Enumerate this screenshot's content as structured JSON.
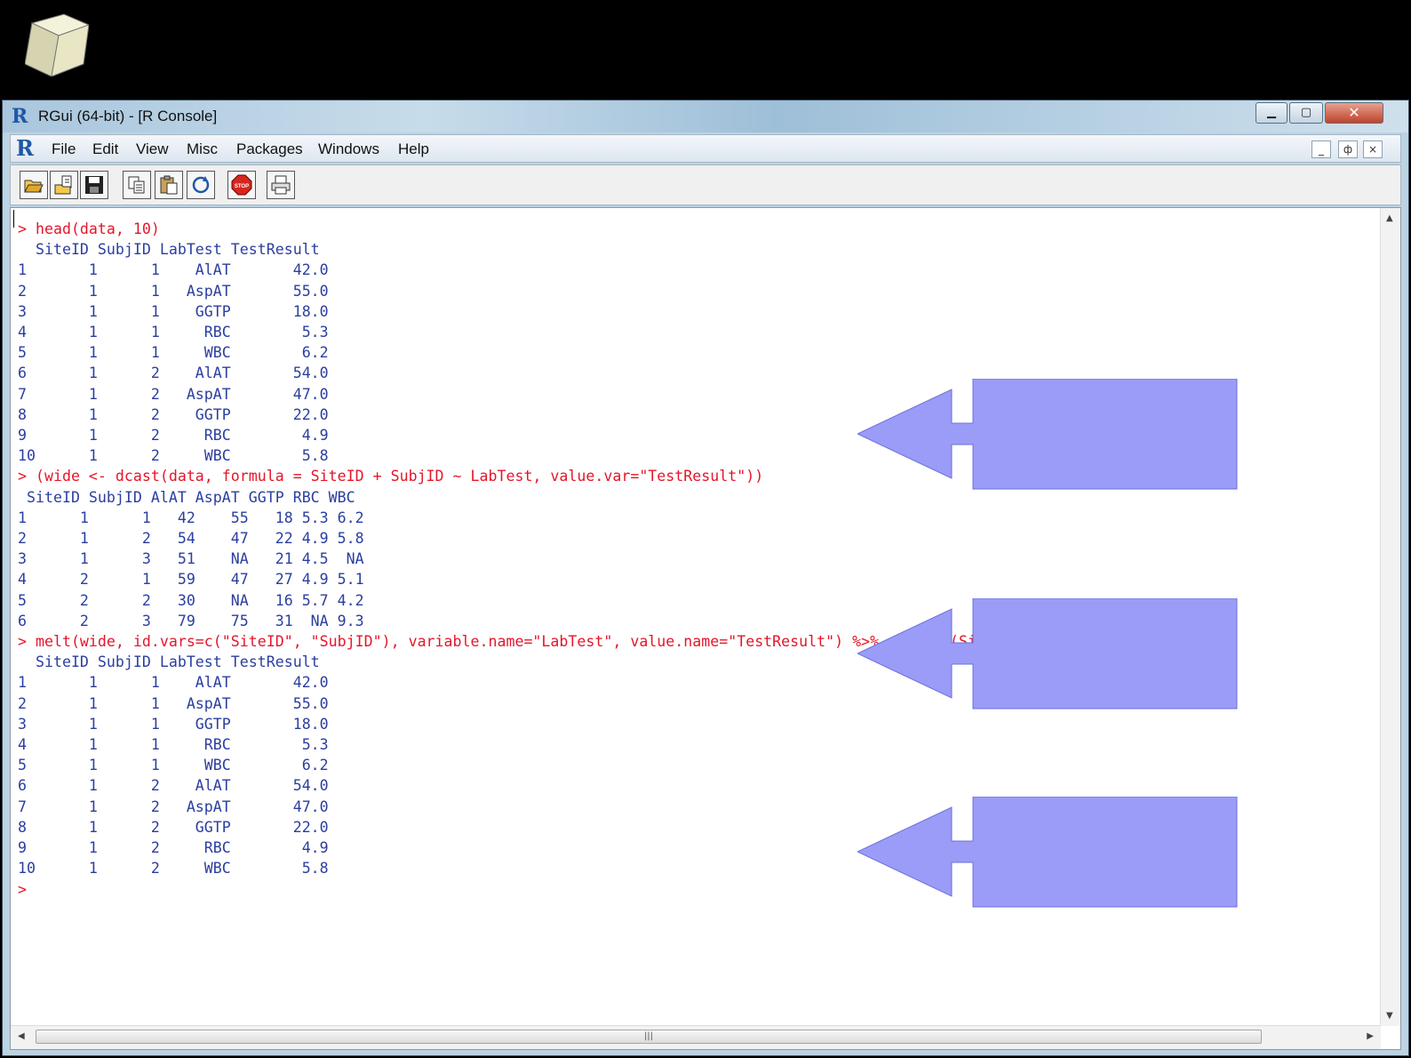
{
  "window": {
    "title": "RGui (64-bit) - [R Console]",
    "app_icon": "R"
  },
  "menu": {
    "items": [
      "File",
      "Edit",
      "View",
      "Misc",
      "Packages",
      "Windows",
      "Help"
    ],
    "mdi_buttons": [
      "_",
      "ф",
      "×"
    ]
  },
  "toolbar": {
    "buttons": [
      "open-script-icon",
      "load-workspace-icon",
      "save-icon",
      "copy-icon",
      "paste-icon",
      "refresh-icon",
      "stop-icon",
      "print-icon"
    ]
  },
  "console": {
    "lines": [
      {
        "type": "cmd",
        "text": "> head(data, 10)"
      },
      {
        "type": "out",
        "text": "  SiteID SubjID LabTest TestResult"
      },
      {
        "type": "out",
        "text": "1       1      1    AlAT       42.0"
      },
      {
        "type": "out",
        "text": "2       1      1   AspAT       55.0"
      },
      {
        "type": "out",
        "text": "3       1      1    GGTP       18.0"
      },
      {
        "type": "out",
        "text": "4       1      1     RBC        5.3"
      },
      {
        "type": "out",
        "text": "5       1      1     WBC        6.2"
      },
      {
        "type": "out",
        "text": "6       1      2    AlAT       54.0"
      },
      {
        "type": "out",
        "text": "7       1      2   AspAT       47.0"
      },
      {
        "type": "out",
        "text": "8       1      2    GGTP       22.0"
      },
      {
        "type": "out",
        "text": "9       1      2     RBC        4.9"
      },
      {
        "type": "out",
        "text": "10      1      2     WBC        5.8"
      },
      {
        "type": "cmd",
        "text": "> (wide <- dcast(data, formula = SiteID + SubjID ~ LabTest, value.var=\"TestResult\"))"
      },
      {
        "type": "out",
        "text": " SiteID SubjID AlAT AspAT GGTP RBC WBC"
      },
      {
        "type": "out",
        "text": "1      1      1   42    55   18 5.3 6.2"
      },
      {
        "type": "out",
        "text": "2      1      2   54    47   22 4.9 5.8"
      },
      {
        "type": "out",
        "text": "3      1      3   51    NA   21 4.5  NA"
      },
      {
        "type": "out",
        "text": "4      2      1   59    47   27 4.9 5.1"
      },
      {
        "type": "out",
        "text": "5      2      2   30    NA   16 5.7 4.2"
      },
      {
        "type": "out",
        "text": "6      2      3   79    75   31  NA 9.3"
      },
      {
        "type": "cmd",
        "text": "> melt(wide, id.vars=c(\"SiteID\", \"SubjID\"), variable.name=\"LabTest\", value.name=\"TestResult\") %>% arrange(SiteID, SubjID) %>% hea$"
      },
      {
        "type": "out",
        "text": "  SiteID SubjID LabTest TestResult"
      },
      {
        "type": "out",
        "text": "1       1      1    AlAT       42.0"
      },
      {
        "type": "out",
        "text": "2       1      1   AspAT       55.0"
      },
      {
        "type": "out",
        "text": "3       1      1    GGTP       18.0"
      },
      {
        "type": "out",
        "text": "4       1      1     RBC        5.3"
      },
      {
        "type": "out",
        "text": "5       1      1     WBC        6.2"
      },
      {
        "type": "out",
        "text": "6       1      2    AlAT       54.0"
      },
      {
        "type": "out",
        "text": "7       1      2   AspAT       47.0"
      },
      {
        "type": "out",
        "text": "8       1      2    GGTP       22.0"
      },
      {
        "type": "out",
        "text": "9       1      2     RBC        4.9"
      },
      {
        "type": "out",
        "text": "10      1      2     WBC        5.8"
      },
      {
        "type": "cmd",
        "text": ">"
      }
    ]
  },
  "colors": {
    "command": "#e4162a",
    "output": "#2b3ea0",
    "callout_fill": "#9a9cf8"
  }
}
